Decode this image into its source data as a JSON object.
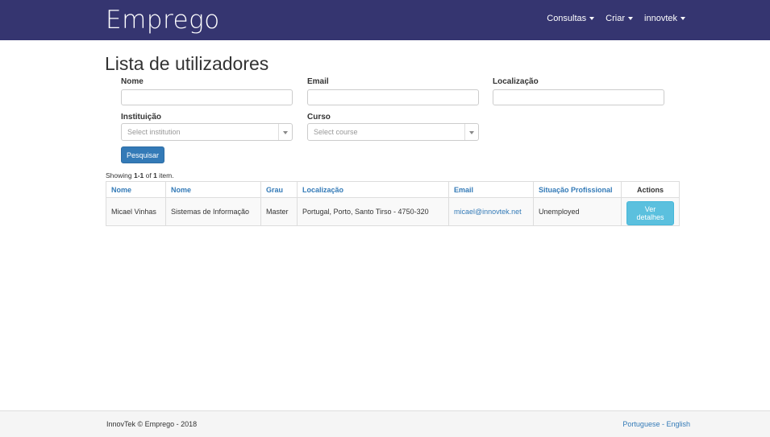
{
  "nav": {
    "brand": "Emprego",
    "items": [
      {
        "label": "Consultas"
      },
      {
        "label": "Criar"
      },
      {
        "label": "innovtek"
      }
    ]
  },
  "page": {
    "title": "Lista de utilizadores"
  },
  "filters": {
    "nome_label": "Nome",
    "nome_value": "",
    "email_label": "Email",
    "email_value": "",
    "localizacao_label": "Localização",
    "localizacao_value": "",
    "instituicao_label": "Instituição",
    "instituicao_placeholder": "Select institution",
    "curso_label": "Curso",
    "curso_placeholder": "Select course",
    "submit_label": "Pesquisar"
  },
  "summary": {
    "prefix": "Showing ",
    "range": "1-1",
    "middle": " of ",
    "total": "1",
    "suffix": " item."
  },
  "table": {
    "headers": [
      "Nome",
      "Nome",
      "Grau",
      "Localização",
      "Email",
      "Situação Profissional",
      "Actions"
    ],
    "rows": [
      {
        "nome": "Micael Vinhas",
        "curso": "Sistemas de Informação",
        "grau": "Master",
        "localizacao": "Portugal, Porto, Santo Tirso - 4750-320",
        "email": "micael@innovtek.net",
        "situacao": "Unemployed",
        "action_label": "Ver detalhes"
      }
    ]
  },
  "footer": {
    "copyright": "InnovTek © Emprego - 2018",
    "lang_pt": "Portuguese",
    "separator": " - ",
    "lang_en": "English"
  },
  "colors": {
    "navbar": "#353570",
    "primary": "#337ab7",
    "info": "#5bc0de"
  }
}
